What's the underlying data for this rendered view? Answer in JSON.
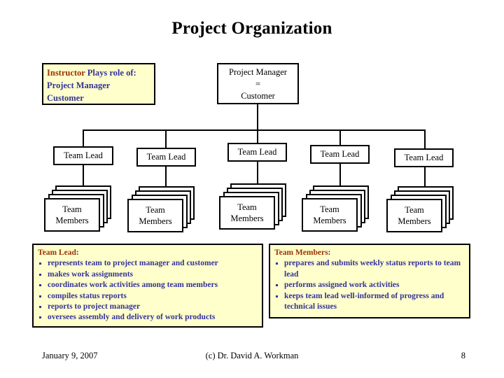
{
  "slide": {
    "title": "Project Organization"
  },
  "instructor_box": {
    "role_word": "Instructor",
    "line1_rest": " Plays role of:",
    "line2": "Project Manager",
    "line3": "Customer"
  },
  "project_manager_box": {
    "line1": "Project Manager",
    "line2": "=",
    "line3": "Customer"
  },
  "team_leads": [
    {
      "label": "Team Lead"
    },
    {
      "label": "Team Lead"
    },
    {
      "label": "Team Lead"
    },
    {
      "label": "Team Lead"
    },
    {
      "label": "Team Lead"
    }
  ],
  "team_member_stacks": [
    {
      "line1": "Team",
      "line2": "Members"
    },
    {
      "line1": "Team",
      "line2": "Members"
    },
    {
      "line1": "Team",
      "line2": "Members"
    },
    {
      "line1": "Team",
      "line2": "Members"
    },
    {
      "line1": "Team",
      "line2": "Members"
    }
  ],
  "team_lead_role": {
    "title": "Team Lead",
    "colon": ":",
    "items": [
      "represents team to project manager and customer",
      "makes work assignments",
      "coordinates work activities among team members",
      "compiles status reports",
      "reports to project manager",
      "oversees assembly and delivery of work products"
    ]
  },
  "team_members_role": {
    "title": "Team Members",
    "colon": ":",
    "items": [
      "prepares and submits weekly status reports to team lead",
      "performs assigned work activities",
      "keeps team lead well-informed of progress and technical issues"
    ]
  },
  "footer": {
    "date": "January 9, 2007",
    "copyright": "(c) Dr. David A. Workman",
    "page_number": "8"
  },
  "colors": {
    "accent_red": "#993300",
    "accent_blue": "#333399",
    "box_yellow": "#ffffcc",
    "outline": "#000000",
    "background": "#ffffff"
  }
}
